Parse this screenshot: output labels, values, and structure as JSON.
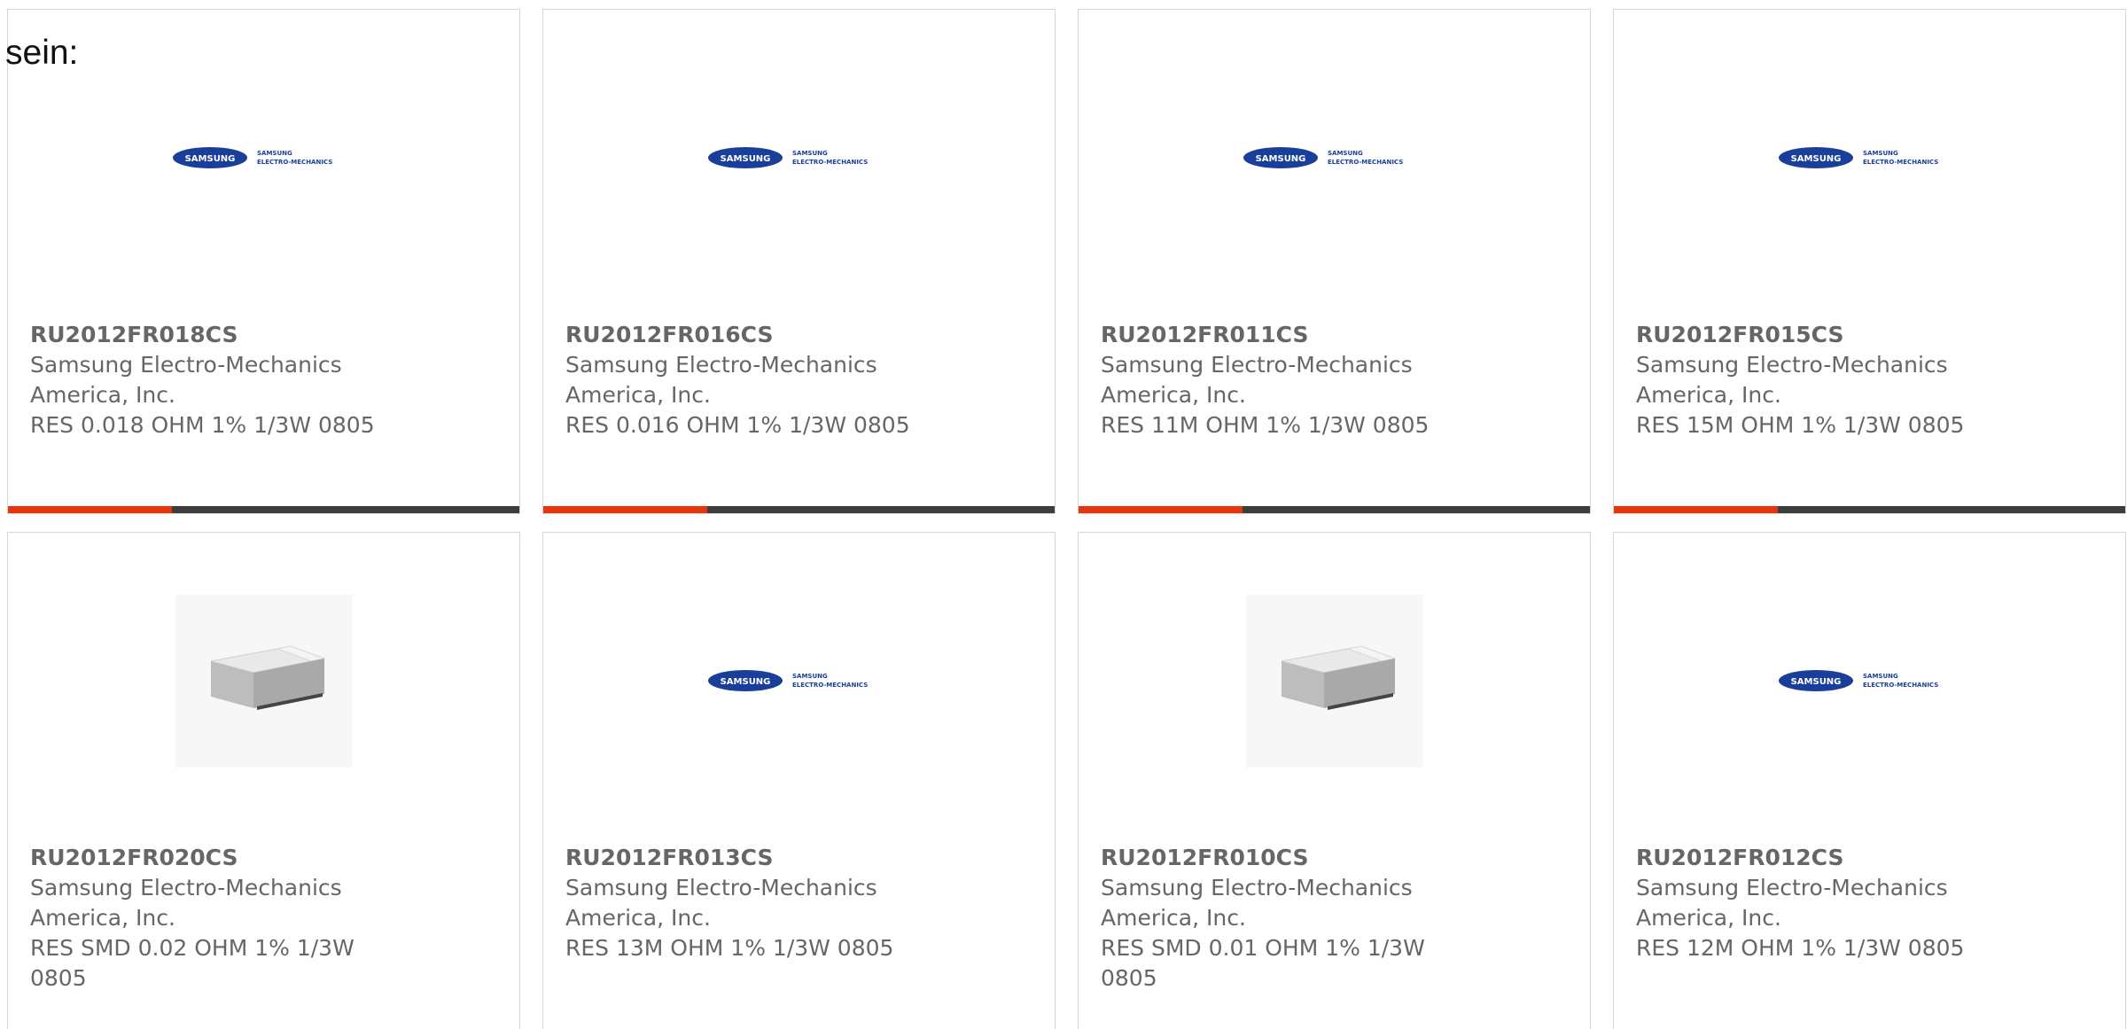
{
  "page_label": "sein:",
  "colors": {
    "accent": "#e8360c",
    "bar": "#3d3d3d",
    "text": "#666666",
    "border": "#d6d6d6",
    "samsung_blue": "#1a3f9b"
  },
  "logo": {
    "brand": "SAMSUNG",
    "line1": "SAMSUNG",
    "line2": "ELECTRO-MECHANICS"
  },
  "cards": [
    {
      "part": "RU2012FR018CS",
      "mfr": "Samsung Electro-Mechanics America, Inc.",
      "desc": "RES 0.018 OHM 1% 1/3W 0805",
      "image": "samsung-logo",
      "progress": 0.32
    },
    {
      "part": "RU2012FR016CS",
      "mfr": "Samsung Electro-Mechanics America, Inc.",
      "desc": "RES 0.016 OHM 1% 1/3W 0805",
      "image": "samsung-logo",
      "progress": 0.32
    },
    {
      "part": "RU2012FR011CS",
      "mfr": "Samsung Electro-Mechanics America, Inc.",
      "desc": "RES 11M OHM 1% 1/3W 0805",
      "image": "samsung-logo",
      "progress": 0.32
    },
    {
      "part": "RU2012FR015CS",
      "mfr": "Samsung Electro-Mechanics America, Inc.",
      "desc": "RES 15M OHM 1% 1/3W 0805",
      "image": "samsung-logo",
      "progress": 0.32
    },
    {
      "part": "RU2012FR020CS",
      "mfr": "Samsung Electro-Mechanics America, Inc.",
      "desc": "RES SMD 0.02 OHM 1% 1/3W 0805",
      "image": "chip-resistor",
      "progress": null
    },
    {
      "part": "RU2012FR013CS",
      "mfr": "Samsung Electro-Mechanics America, Inc.",
      "desc": "RES 13M OHM 1% 1/3W 0805",
      "image": "samsung-logo",
      "progress": null
    },
    {
      "part": "RU2012FR010CS",
      "mfr": "Samsung Electro-Mechanics America, Inc.",
      "desc": "RES SMD 0.01 OHM 1% 1/3W 0805",
      "image": "chip-resistor",
      "progress": null
    },
    {
      "part": "RU2012FR012CS",
      "mfr": "Samsung Electro-Mechanics America, Inc.",
      "desc": "RES 12M OHM 1% 1/3W 0805",
      "image": "samsung-logo",
      "progress": null
    }
  ]
}
